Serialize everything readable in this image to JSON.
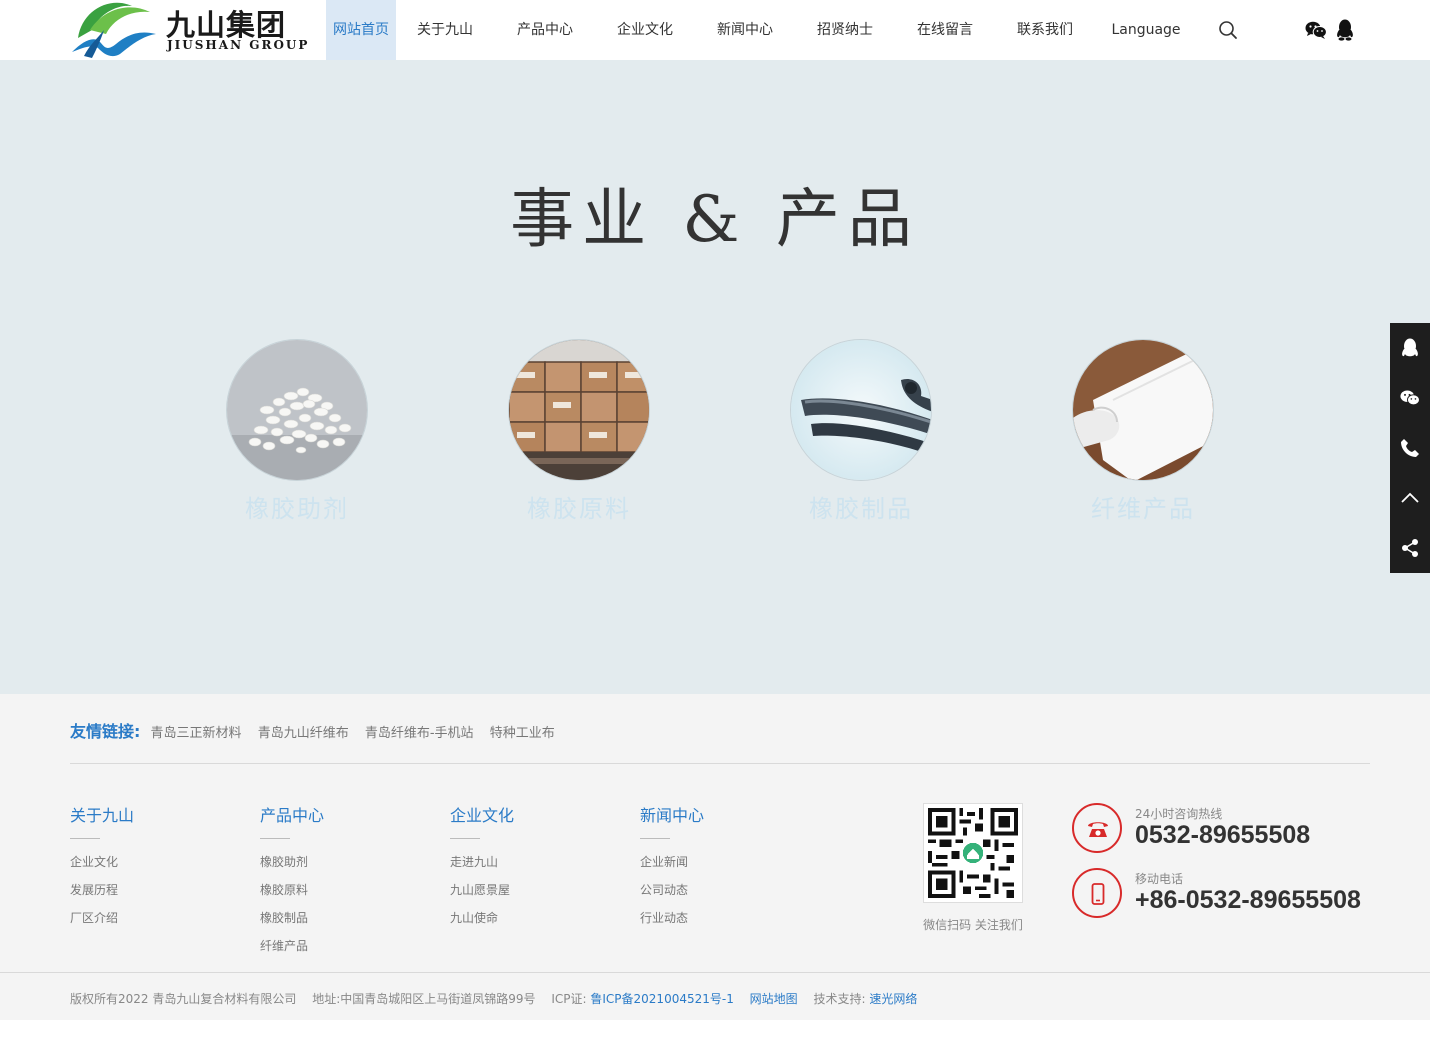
{
  "logo": {
    "cn": "九山集团",
    "en": "JIUSHAN GROUP"
  },
  "nav": [
    {
      "label": "网站首页",
      "active": true
    },
    {
      "label": "关于九山"
    },
    {
      "label": "产品中心"
    },
    {
      "label": "企业文化"
    },
    {
      "label": "新闻中心"
    },
    {
      "label": "招贤纳士"
    },
    {
      "label": "在线留言"
    },
    {
      "label": "联系我们"
    },
    {
      "label": "Language"
    }
  ],
  "hero": {
    "title": "事业 & 产品",
    "products": [
      {
        "label": "橡胶助剂"
      },
      {
        "label": "橡胶原料"
      },
      {
        "label": "橡胶制品"
      },
      {
        "label": "纤维产品"
      }
    ]
  },
  "friend_links": {
    "title": "友情链接:",
    "items": [
      "青岛三正新材料",
      "青岛九山纤维布",
      "青岛纤维布-手机站",
      "特种工业布"
    ]
  },
  "footer_columns": [
    {
      "title": "关于九山",
      "items": [
        "企业文化",
        "发展历程",
        "厂区介绍"
      ]
    },
    {
      "title": "产品中心",
      "items": [
        "橡胶助剂",
        "橡胶原料",
        "橡胶制品",
        "纤维产品"
      ]
    },
    {
      "title": "企业文化",
      "items": [
        "走进九山",
        "九山愿景屋",
        "九山使命"
      ]
    },
    {
      "title": "新闻中心",
      "items": [
        "企业新闻",
        "公司动态",
        "行业动态"
      ]
    }
  ],
  "qr_caption": "微信扫码 关注我们",
  "contacts": [
    {
      "label": "24小时咨询热线",
      "number": "0532-89655508"
    },
    {
      "label": "移动电话",
      "number": "+86-0532-89655508"
    }
  ],
  "copyright": {
    "text": "版权所有2022 青岛九山复合材料有限公司",
    "address": "地址:中国青岛城阳区上马街道凤锦路99号",
    "icp_label": "ICP证:",
    "icp": "鲁ICP备2021004521号-1",
    "sitemap": "网站地图",
    "support_label": "技术支持:",
    "support": "速光网络"
  },
  "colors": {
    "accent": "#2b7bc7",
    "hero_bg": "#e3ebee",
    "footer_bg": "#f4f4f4",
    "contact_red": "#d82a2a",
    "sidebar": "#1e1e1e"
  }
}
